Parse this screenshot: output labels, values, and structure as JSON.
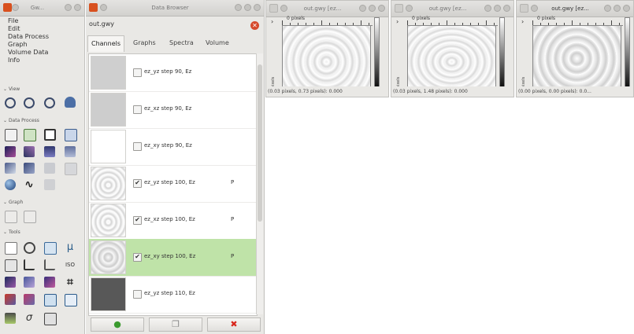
{
  "toolbox": {
    "title": "Gw...",
    "menu": [
      "File",
      "Edit",
      "Data Process",
      "Graph",
      "Volume Data",
      "Info"
    ],
    "sections": [
      "View",
      "Data Process",
      "Graph",
      "Tools"
    ]
  },
  "browser": {
    "title": "Data Browser",
    "filename": "out.gwy",
    "close_glyph": "✕",
    "tabs": [
      "Channels",
      "Graphs",
      "Spectra",
      "Volume"
    ],
    "channels": [
      {
        "title": "ez_yz step 90, Ez",
        "visible": false,
        "flag": "",
        "selected": false
      },
      {
        "title": "ez_xz step 90, Ez",
        "visible": false,
        "flag": "",
        "selected": false
      },
      {
        "title": "ez_xy step 90, Ez",
        "visible": false,
        "flag": "",
        "selected": false
      },
      {
        "title": "ez_yz step 100, Ez",
        "visible": true,
        "flag": "P",
        "selected": false
      },
      {
        "title": "ez_xz step 100, Ez",
        "visible": true,
        "flag": "P",
        "selected": false
      },
      {
        "title": "ez_xy step 100, Ez",
        "visible": true,
        "flag": "P",
        "selected": true
      },
      {
        "title": "ez_yz step 110, Ez",
        "visible": false,
        "flag": "",
        "selected": false
      }
    ],
    "buttons": [
      {
        "name": "new-channel",
        "glyph": "●"
      },
      {
        "name": "duplicate-channel",
        "glyph": "❐"
      },
      {
        "name": "delete-channel",
        "glyph": "✖"
      }
    ]
  },
  "windows": [
    {
      "title": "out.gwy [ez...",
      "ruler_label": "0 pixels",
      "ylabel": "0 pixels",
      "status": "(0.03 pixels, 0.73 pixels): 0.000"
    },
    {
      "title": "out.gwy [ez...",
      "ruler_label": "0 pixels",
      "ylabel": "0 pixels",
      "status": "(0.03 pixels, 1.48 pixels): 0.000"
    },
    {
      "title": "out.gwy [ez...",
      "ruler_label": "0 pixels",
      "ylabel": "0 pixels",
      "status": "(0.00 pixels, 0.00 pixels): 0.0..."
    }
  ],
  "colors": {
    "accent_selected": "#bfe3a8",
    "app_icon": "#d8501e",
    "delete": "#d8261c",
    "new": "#3a9a2e"
  }
}
